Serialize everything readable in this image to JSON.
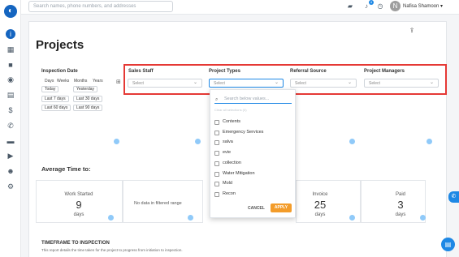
{
  "topbar": {
    "search_placeholder": "Search names, phone numbers, and addresses",
    "notification_count": "4",
    "user_name": "Nafisa Shamoon",
    "avatar_initial": "N"
  },
  "sidebar": {
    "logo_icon": "company-logo-icon",
    "items": [
      {
        "icon": "info-icon",
        "glyph": "i"
      },
      {
        "icon": "building-icon",
        "glyph": "▦"
      },
      {
        "icon": "briefcase-icon",
        "glyph": "■"
      },
      {
        "icon": "camera-icon",
        "glyph": "◉"
      },
      {
        "icon": "map-icon",
        "glyph": "▤"
      },
      {
        "icon": "dollar-icon",
        "glyph": "$"
      },
      {
        "icon": "phone-icon",
        "glyph": "✆"
      },
      {
        "icon": "folder-icon",
        "glyph": "▬"
      },
      {
        "icon": "truck-icon",
        "glyph": "▶"
      },
      {
        "icon": "team-icon",
        "glyph": "☻"
      },
      {
        "icon": "gear-icon",
        "glyph": "⚙"
      }
    ]
  },
  "page": {
    "title": "Projects"
  },
  "filters": {
    "inspection_date": {
      "label": "Inspection Date",
      "units": [
        "Days",
        "Weeks",
        "Months",
        "Years"
      ],
      "quick": [
        "Today",
        "Yesterday",
        "Last 7 days",
        "Last 30 days",
        "Last 60 days",
        "Last 90 days"
      ]
    },
    "sales_staff": {
      "label": "Sales Staff",
      "value": "Select"
    },
    "project_types": {
      "label": "Project Types",
      "value": "Select"
    },
    "referral_source": {
      "label": "Referral Source",
      "value": "Select"
    },
    "project_managers": {
      "label": "Project Managers",
      "value": "Select"
    }
  },
  "dropdown": {
    "search_placeholder": "Search below values...",
    "hint": "Clear all selections (0)",
    "options": [
      "Contents",
      "Emergency Services",
      "salva",
      "evie",
      "collection",
      "Water Mitigation",
      "Mold",
      "Recon"
    ],
    "cancel_label": "CANCEL",
    "apply_label": "APPLY"
  },
  "average_time": {
    "title": "Average Time to:",
    "metrics": [
      {
        "label": "Work Started",
        "value": "9",
        "unit": "days"
      },
      {
        "label": "Invoice",
        "value": "25",
        "unit": "days"
      },
      {
        "label": "Paid",
        "value": "3",
        "unit": "days"
      }
    ],
    "no_data": "No data in filtered range"
  },
  "timeframe": {
    "title": "TIMEFRAME TO INSPECTION",
    "description": "This report details the time taken for the project to progress from initiation to inspection."
  }
}
